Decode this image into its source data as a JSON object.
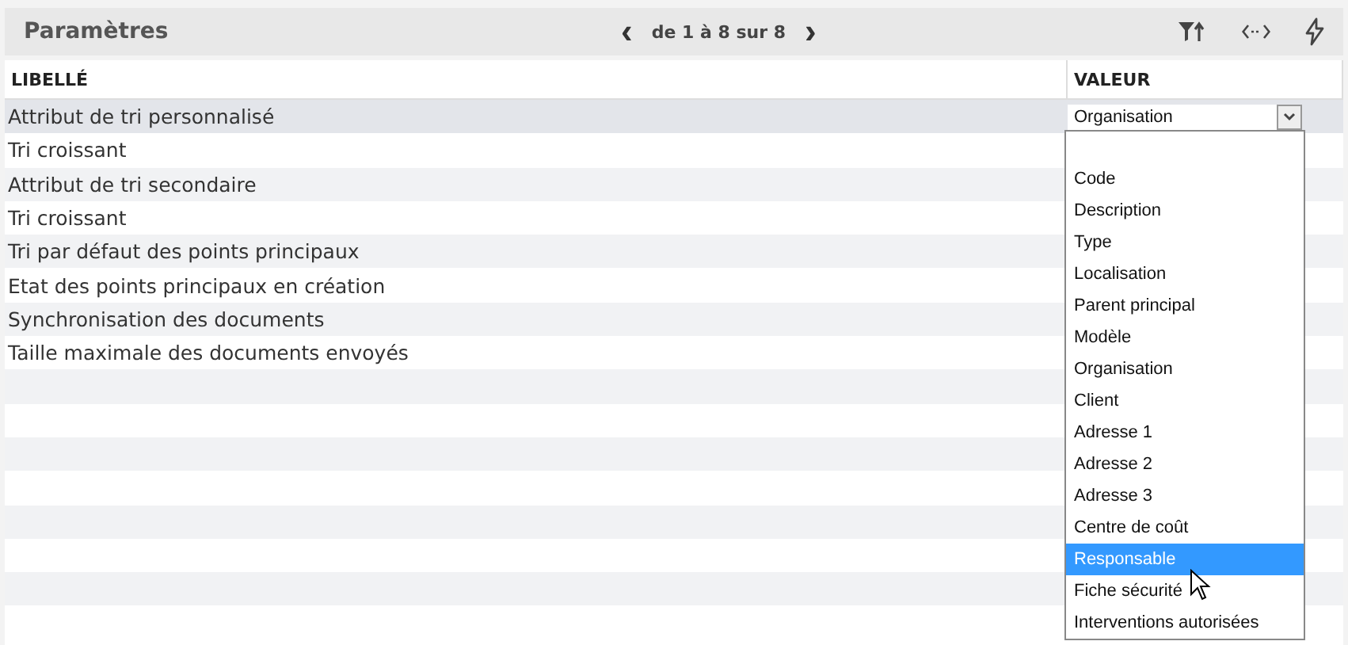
{
  "header": {
    "title": "Paramètres",
    "pager": "de 1 à 8 sur 8",
    "prev": "‹",
    "next": "›"
  },
  "table": {
    "columns": [
      "LIBELLÉ",
      "VALEUR"
    ],
    "rows": [
      {
        "label": "Attribut de tri personnalisé",
        "selected": true
      },
      {
        "label": "Tri croissant",
        "selected": false
      },
      {
        "label": "Attribut de tri secondaire",
        "selected": false
      },
      {
        "label": "Tri croissant",
        "selected": false
      },
      {
        "label": "Tri par défaut des points principaux",
        "selected": false
      },
      {
        "label": "Etat des points principaux en création",
        "selected": false
      },
      {
        "label": "Synchronisation des documents",
        "selected": false
      },
      {
        "label": "Taille maximale des documents envoyés",
        "selected": false
      }
    ]
  },
  "dropdown": {
    "value": "Organisation",
    "expanded": true,
    "options": [
      {
        "label": "Code",
        "highlighted": false
      },
      {
        "label": "Description",
        "highlighted": false
      },
      {
        "label": "Type",
        "highlighted": false
      },
      {
        "label": "Localisation",
        "highlighted": false
      },
      {
        "label": "Parent principal",
        "highlighted": false
      },
      {
        "label": "Modèle",
        "highlighted": false
      },
      {
        "label": "Organisation",
        "highlighted": false
      },
      {
        "label": "Client",
        "highlighted": false
      },
      {
        "label": "Adresse 1",
        "highlighted": false
      },
      {
        "label": "Adresse 2",
        "highlighted": false
      },
      {
        "label": "Adresse 3",
        "highlighted": false
      },
      {
        "label": "Centre de coût",
        "highlighted": false
      },
      {
        "label": "Responsable",
        "highlighted": true
      },
      {
        "label": "Fiche sécurité",
        "highlighted": false
      },
      {
        "label": "Interventions autorisées",
        "highlighted": false
      }
    ]
  }
}
